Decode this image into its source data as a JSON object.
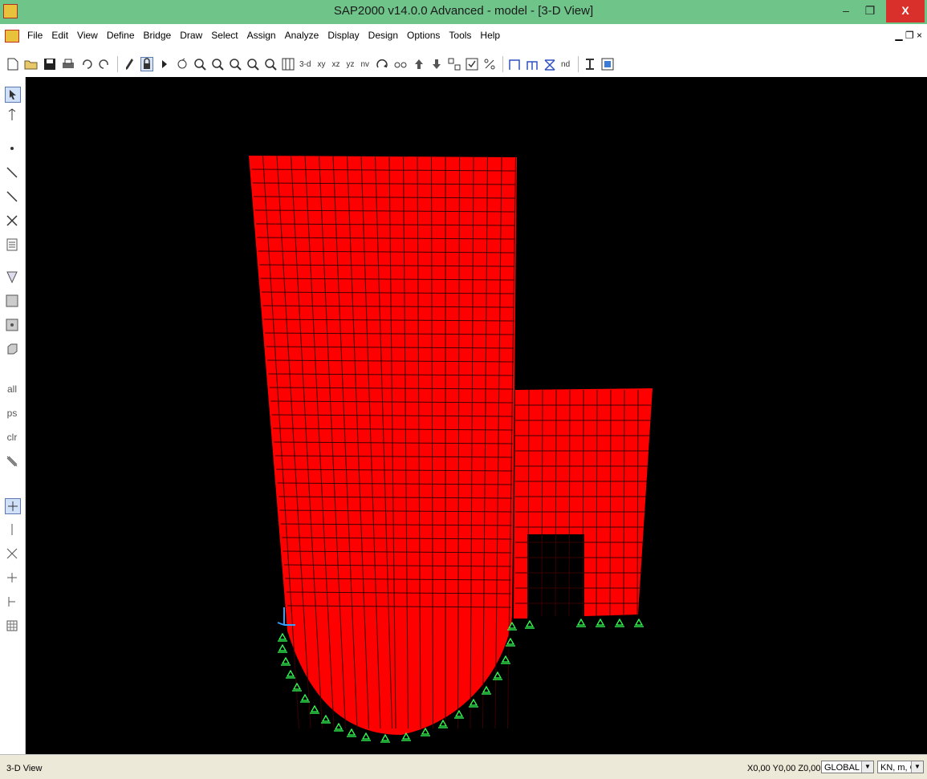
{
  "window": {
    "title": "SAP2000 v14.0.0 Advanced  - model - [3-D View]",
    "min_glyph": "–",
    "max_glyph": "❐",
    "close_glyph": "X",
    "child_controls": "▁ ❐ ×"
  },
  "menu": {
    "items": [
      "File",
      "Edit",
      "View",
      "Define",
      "Bridge",
      "Draw",
      "Select",
      "Assign",
      "Analyze",
      "Display",
      "Design",
      "Options",
      "Tools",
      "Help"
    ]
  },
  "toolbar": {
    "view_3d": "3-d",
    "view_xy": "xy",
    "view_xz": "xz",
    "view_yz": "yz",
    "view_nv": "nv",
    "nd": "nd"
  },
  "left_toolbar": {
    "all": "all",
    "ps": "ps",
    "clr": "clr"
  },
  "status": {
    "view_name": "3-D View",
    "coords": "X0,00  Y0,00  Z0,00",
    "coord_system": "GLOBAL",
    "units": "KN, m, C"
  },
  "icons": {
    "pointer": "pointer-icon",
    "support": "pin-support-icon"
  },
  "colors": {
    "shell": "#ff0000",
    "mesh_line": "#300000",
    "support": "#33ff55",
    "background": "#000000",
    "titlebar": "#6fc48a"
  }
}
